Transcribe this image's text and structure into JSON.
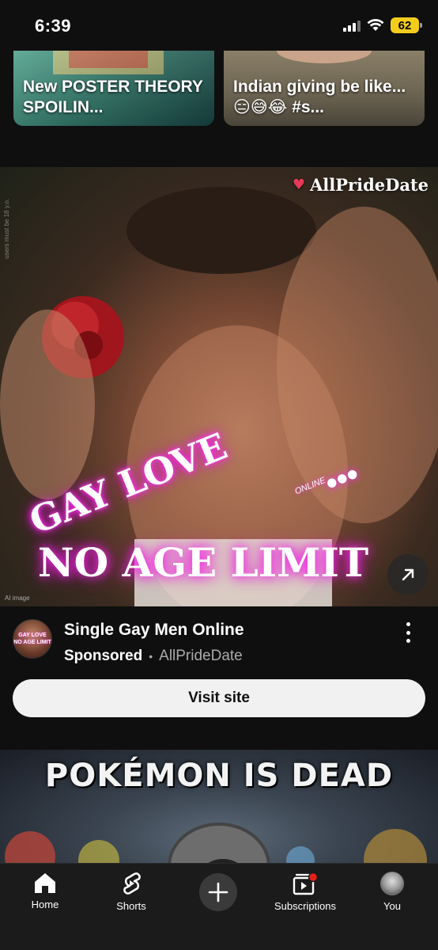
{
  "status_bar": {
    "time": "6:39",
    "battery": "62",
    "battery_color": "#f2cd1d"
  },
  "shorts": [
    {
      "title": "New POSTER THEORY SPOILIN..."
    },
    {
      "title": "Indian giving be like... 😑😅😂 #s..."
    }
  ],
  "ad": {
    "image": {
      "brand": "AllPrideDate",
      "headline_line1": "GAY LOVE",
      "headline_online": "ONLINE",
      "headline_dots": "•••",
      "headline_line2": "NO AGE LIMIT",
      "ai_tag": "AI image",
      "disclaimer": "users must be 18 y.o.",
      "open_icon": "arrow-up-right-icon"
    },
    "title": "Single Gay Men Online",
    "sponsored_label": "Sponsored",
    "separator": "•",
    "domain": "AllPrideDate",
    "cta": "Visit site"
  },
  "next_video": {
    "title": "POKÉMON IS DEAD"
  },
  "bottom_nav": {
    "items": [
      {
        "label": "Home",
        "icon": "home-icon"
      },
      {
        "label": "Shorts",
        "icon": "shorts-icon"
      },
      {
        "label": "",
        "icon": "plus-icon"
      },
      {
        "label": "Subscriptions",
        "icon": "subscriptions-icon"
      },
      {
        "label": "You",
        "icon": "avatar"
      }
    ],
    "notification_color": "#e62117"
  }
}
